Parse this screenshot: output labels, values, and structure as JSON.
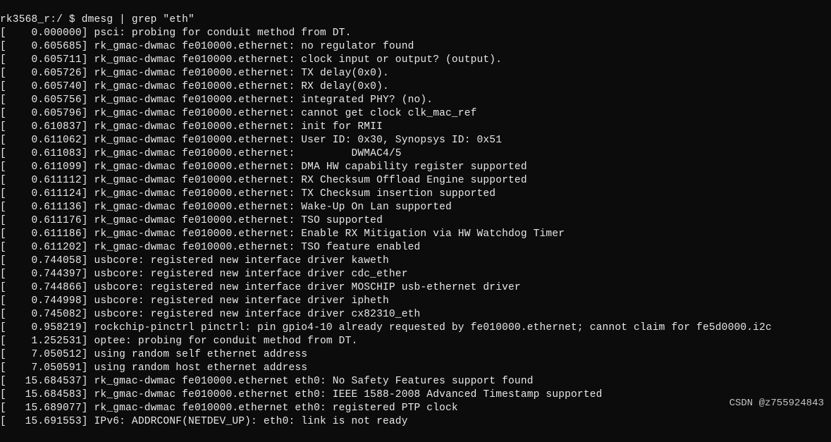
{
  "terminal": {
    "prompt_line": "rk3568_r:/ $ dmesg | grep \"eth\"",
    "lines": [
      "[    0.000000] psci: probing for conduit method from DT.",
      "[    0.605685] rk_gmac-dwmac fe010000.ethernet: no regulator found",
      "[    0.605711] rk_gmac-dwmac fe010000.ethernet: clock input or output? (output).",
      "[    0.605726] rk_gmac-dwmac fe010000.ethernet: TX delay(0x0).",
      "[    0.605740] rk_gmac-dwmac fe010000.ethernet: RX delay(0x0).",
      "[    0.605756] rk_gmac-dwmac fe010000.ethernet: integrated PHY? (no).",
      "[    0.605796] rk_gmac-dwmac fe010000.ethernet: cannot get clock clk_mac_ref",
      "[    0.610837] rk_gmac-dwmac fe010000.ethernet: init for RMII",
      "[    0.611062] rk_gmac-dwmac fe010000.ethernet: User ID: 0x30, Synopsys ID: 0x51",
      "[    0.611083] rk_gmac-dwmac fe010000.ethernet:         DWMAC4/5",
      "[    0.611099] rk_gmac-dwmac fe010000.ethernet: DMA HW capability register supported",
      "[    0.611112] rk_gmac-dwmac fe010000.ethernet: RX Checksum Offload Engine supported",
      "[    0.611124] rk_gmac-dwmac fe010000.ethernet: TX Checksum insertion supported",
      "[    0.611136] rk_gmac-dwmac fe010000.ethernet: Wake-Up On Lan supported",
      "[    0.611176] rk_gmac-dwmac fe010000.ethernet: TSO supported",
      "[    0.611186] rk_gmac-dwmac fe010000.ethernet: Enable RX Mitigation via HW Watchdog Timer",
      "[    0.611202] rk_gmac-dwmac fe010000.ethernet: TSO feature enabled",
      "[    0.744058] usbcore: registered new interface driver kaweth",
      "[    0.744397] usbcore: registered new interface driver cdc_ether",
      "[    0.744866] usbcore: registered new interface driver MOSCHIP usb-ethernet driver",
      "[    0.744998] usbcore: registered new interface driver ipheth",
      "[    0.745082] usbcore: registered new interface driver cx82310_eth",
      "[    0.958219] rockchip-pinctrl pinctrl: pin gpio4-10 already requested by fe010000.ethernet; cannot claim for fe5d0000.i2c",
      "[    1.252531] optee: probing for conduit method from DT.",
      "[    7.050512] using random self ethernet address",
      "[    7.050591] using random host ethernet address",
      "[   15.684537] rk_gmac-dwmac fe010000.ethernet eth0: No Safety Features support found",
      "[   15.684583] rk_gmac-dwmac fe010000.ethernet eth0: IEEE 1588-2008 Advanced Timestamp supported",
      "[   15.689077] rk_gmac-dwmac fe010000.ethernet eth0: registered PTP clock",
      "[   15.691553] IPv6: ADDRCONF(NETDEV_UP): eth0: link is not ready"
    ]
  },
  "watermark": "CSDN @z755924843"
}
